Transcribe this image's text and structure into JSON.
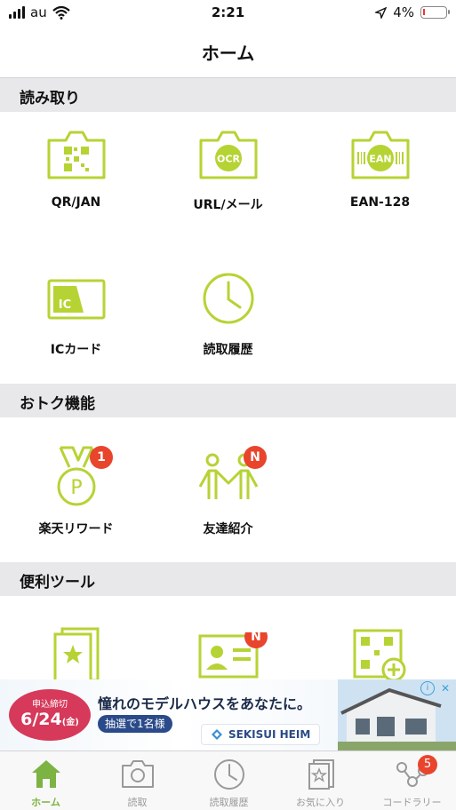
{
  "status_bar": {
    "carrier": "au",
    "time": "2:21",
    "battery": "4%"
  },
  "nav": {
    "title": "ホーム"
  },
  "sections": [
    {
      "title": "読み取り"
    },
    {
      "title": "おトク機能"
    },
    {
      "title": "便利ツール"
    }
  ],
  "scan": {
    "items": [
      {
        "label": "QR/JAN",
        "icon": "qr-camera-icon",
        "icon_text": ""
      },
      {
        "label": "URL/メール",
        "icon": "ocr-camera-icon",
        "icon_text": "OCR"
      },
      {
        "label": "EAN-128",
        "icon": "ean-camera-icon",
        "icon_text": "EAN"
      },
      {
        "label": "ICカード",
        "icon": "ic-card-icon",
        "icon_text": "IC"
      },
      {
        "label": "読取履歴",
        "icon": "clock-icon",
        "icon_text": ""
      }
    ]
  },
  "deals": {
    "items": [
      {
        "label": "楽天リワード",
        "icon": "medal-icon",
        "icon_text": "P",
        "badge": "1"
      },
      {
        "label": "友達紹介",
        "icon": "friends-icon",
        "badge": "N"
      }
    ]
  },
  "tools": {
    "items": [
      {
        "icon": "favorites-book-icon"
      },
      {
        "icon": "profile-card-icon",
        "badge": "N"
      },
      {
        "icon": "qr-create-icon"
      }
    ]
  },
  "ad": {
    "deadline_label": "申込締切",
    "deadline_date": "6/24",
    "deadline_day": "(金)",
    "headline": "憧れのモデルハウスをあなたに。",
    "pill": "抽選で1名様",
    "brand": "SEKISUI HEIM",
    "info_icon": "info-icon",
    "close_icon": "close-icon"
  },
  "tabs": [
    {
      "label": "ホーム",
      "icon": "home-icon",
      "active": true
    },
    {
      "label": "読取",
      "icon": "camera-icon",
      "active": false
    },
    {
      "label": "読取履歴",
      "icon": "clock-icon",
      "active": false
    },
    {
      "label": "お気に入り",
      "icon": "star-book-icon",
      "active": false
    },
    {
      "label": "コードラリー",
      "icon": "rally-icon",
      "active": false,
      "badge": "5"
    }
  ],
  "colors": {
    "accent": "#b6d334",
    "active_tab": "#7cb342",
    "badge": "#e8452c",
    "section_bg": "#e8e8ea"
  }
}
